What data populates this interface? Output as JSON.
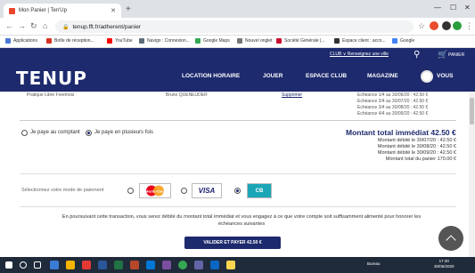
{
  "browser": {
    "tab_title": "Mon Panier | Ten'Up",
    "url": "tenup.fft.fr/adherent/panier",
    "bookmarks": [
      "Applications",
      "Boîte de réception...",
      "YouTube",
      "Navigo : Connexion...",
      "Google Maps",
      "Nouvel onglet",
      "Société Générale |...",
      "Espace client : acco...",
      "Google"
    ]
  },
  "site": {
    "logo": "TENUP",
    "club_link": "CLUB ∨  Renseignez une ville",
    "cart_label": "PANIER",
    "nav": [
      "LOCATION HORAIRE",
      "JOUER",
      "ESPACE CLUB",
      "MAGAZINE",
      "VOUS"
    ]
  },
  "order": {
    "product": "Pratique Libre Freemois",
    "person": "Bruno QUENEUDER",
    "remove": "Supprimer",
    "echeances": [
      "Echéance 1/4 au 30/06/20 : 42.50 €",
      "Echéance 2/4 au 30/07/20 : 42.50 €",
      "Echéance 3/4 au 30/08/20 : 42.50 €",
      "Echéance 4/4 au 30/09/20 : 42.50 €"
    ]
  },
  "payment": {
    "opt_comptant": "Je paye au comptant",
    "opt_plusieurs": "Je paye en plusieurs fois",
    "montant_title": "Montant total immédiat 42.50 €",
    "debits": [
      "Montant débité le 30/07/20 : 42.50 €",
      "Montant débité le 30/08/20 : 42.50 €",
      "Montant débité le 30/09/20 : 42.50 €",
      "Montant total du panier 170.00 €"
    ],
    "select_mode": "Sélectionnez votre mode de paiement",
    "cards": [
      "MasterCard",
      "VISA",
      "CB"
    ],
    "info": "En poursuivant cette transaction, vous serez débité du montant total immédiat et vous engagez à ce que votre compte soit suffisamment alimenté pour honorer les échéances suivantes",
    "validate": "VALIDER ET PAYER 42.50 €"
  },
  "taskbar": {
    "tray": "Bureau",
    "time": "17:30",
    "date": "30/06/2020"
  }
}
